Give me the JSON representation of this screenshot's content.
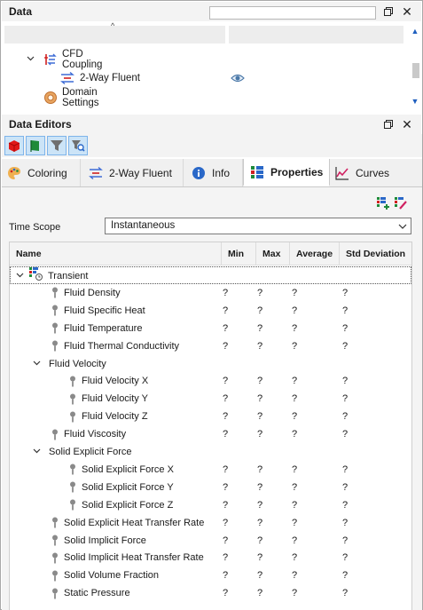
{
  "data_panel": {
    "title": "Data",
    "tree": [
      {
        "label": "CFD Coupling",
        "expanded": true,
        "icon": "cfd-coupling-icon"
      },
      {
        "label": "2-Way Fluent",
        "icon": "two-way-fluent-icon",
        "visible_icon": "eye-icon"
      },
      {
        "label": "Domain Settings",
        "icon": "domain-settings-icon"
      }
    ]
  },
  "editors_panel": {
    "title": "Data Editors",
    "toolbar": [
      "red-cube-icon",
      "green-flag-icon",
      "filter-icon",
      "search-filter-icon"
    ],
    "tabs": [
      {
        "label": "Coloring",
        "icon": "palette-icon"
      },
      {
        "label": "2-Way Fluent",
        "icon": "two-way-fluent-icon"
      },
      {
        "label": "Info",
        "icon": "info-icon"
      },
      {
        "label": "Properties",
        "icon": "properties-icon",
        "selected": true
      },
      {
        "label": "Curves",
        "icon": "curves-icon"
      }
    ]
  },
  "properties": {
    "time_scope_label": "Time Scope",
    "time_scope_value": "Instantaneous",
    "columns": [
      "Name",
      "Min",
      "Max",
      "Average",
      "Std Deviation"
    ],
    "rows": [
      {
        "label": "Transient",
        "level": 0,
        "type": "group-root"
      },
      {
        "label": "Fluid Density",
        "level": 1,
        "type": "leaf",
        "values": [
          "?",
          "?",
          "?",
          "?"
        ]
      },
      {
        "label": "Fluid Specific Heat",
        "level": 1,
        "type": "leaf",
        "values": [
          "?",
          "?",
          "?",
          "?"
        ]
      },
      {
        "label": "Fluid Temperature",
        "level": 1,
        "type": "leaf",
        "values": [
          "?",
          "?",
          "?",
          "?"
        ]
      },
      {
        "label": "Fluid Thermal Conductivity",
        "level": 1,
        "type": "leaf",
        "values": [
          "?",
          "?",
          "?",
          "?"
        ]
      },
      {
        "label": "Fluid Velocity",
        "level": 1,
        "type": "group"
      },
      {
        "label": "Fluid Velocity X",
        "level": 2,
        "type": "leaf",
        "values": [
          "?",
          "?",
          "?",
          "?"
        ]
      },
      {
        "label": "Fluid Velocity Y",
        "level": 2,
        "type": "leaf",
        "values": [
          "?",
          "?",
          "?",
          "?"
        ]
      },
      {
        "label": "Fluid Velocity Z",
        "level": 2,
        "type": "leaf",
        "values": [
          "?",
          "?",
          "?",
          "?"
        ]
      },
      {
        "label": "Fluid Viscosity",
        "level": 1,
        "type": "leaf",
        "values": [
          "?",
          "?",
          "?",
          "?"
        ]
      },
      {
        "label": "Solid Explicit Force",
        "level": 1,
        "type": "group"
      },
      {
        "label": "Solid Explicit Force X",
        "level": 2,
        "type": "leaf",
        "values": [
          "?",
          "?",
          "?",
          "?"
        ]
      },
      {
        "label": "Solid Explicit Force Y",
        "level": 2,
        "type": "leaf",
        "values": [
          "?",
          "?",
          "?",
          "?"
        ]
      },
      {
        "label": "Solid Explicit Force Z",
        "level": 2,
        "type": "leaf",
        "values": [
          "?",
          "?",
          "?",
          "?"
        ]
      },
      {
        "label": "Solid Explicit Heat Transfer Rate",
        "level": 1,
        "type": "leaf",
        "values": [
          "?",
          "?",
          "?",
          "?"
        ]
      },
      {
        "label": "Solid Implicit Force",
        "level": 1,
        "type": "leaf",
        "values": [
          "?",
          "?",
          "?",
          "?"
        ]
      },
      {
        "label": "Solid Implicit Heat Transfer Rate",
        "level": 1,
        "type": "leaf",
        "values": [
          "?",
          "?",
          "?",
          "?"
        ]
      },
      {
        "label": "Solid Volume Fraction",
        "level": 1,
        "type": "leaf",
        "values": [
          "?",
          "?",
          "?",
          "?"
        ]
      },
      {
        "label": "Static Pressure",
        "level": 1,
        "type": "leaf",
        "values": [
          "?",
          "?",
          "?",
          "?"
        ]
      }
    ]
  }
}
